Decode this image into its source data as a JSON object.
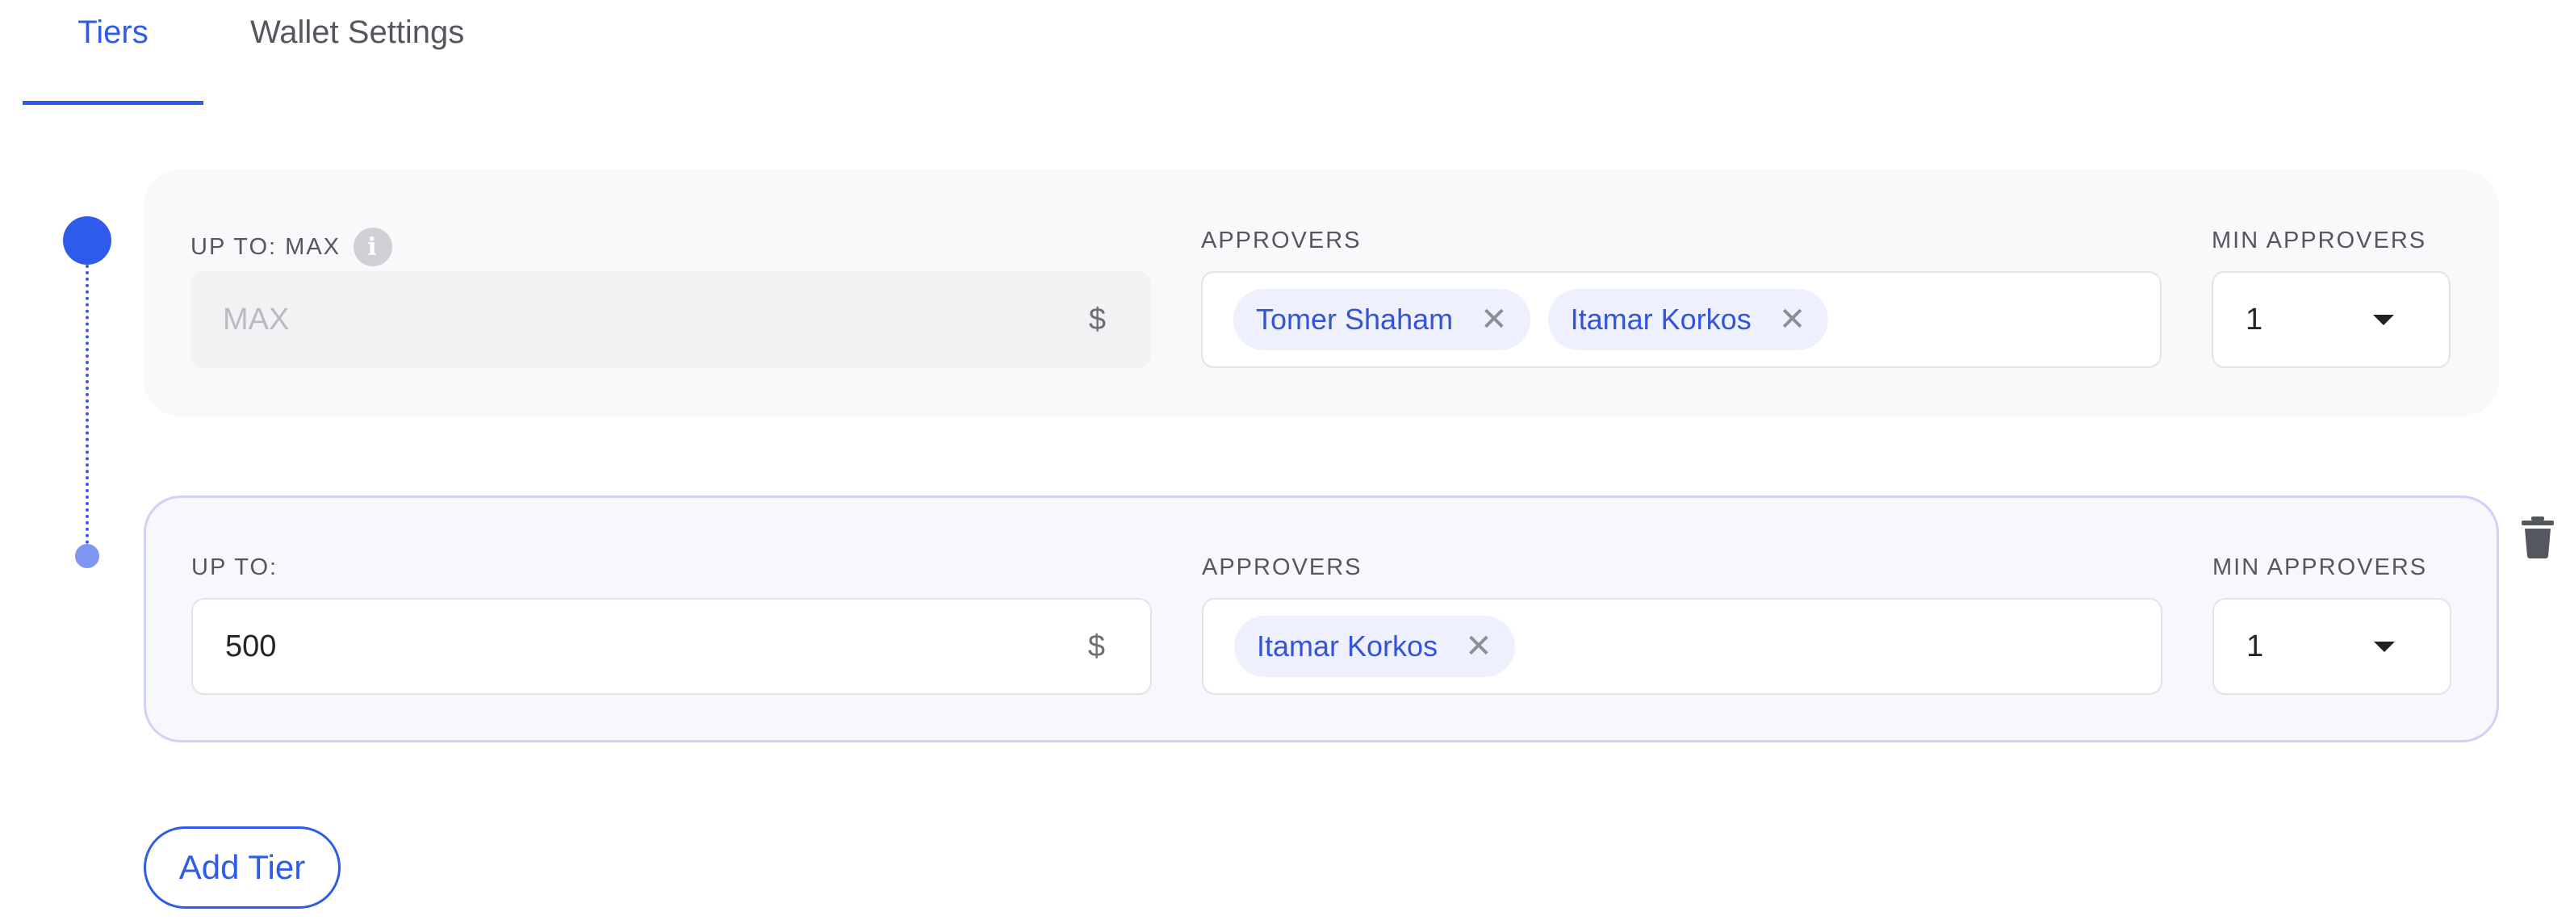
{
  "tabs": [
    {
      "label": "Tiers",
      "active": true
    },
    {
      "label": "Wallet Settings",
      "active": false
    }
  ],
  "tiers": [
    {
      "amount_label": "UP TO: MAX",
      "amount_placeholder": "MAX",
      "amount_value": "",
      "amount_disabled": true,
      "currency_symbol": "$",
      "approvers_label": "APPROVERS",
      "approvers": [
        "Tomer Shaham",
        "Itamar Korkos"
      ],
      "min_approvers_label": "MIN APPROVERS",
      "min_approvers_value": "1"
    },
    {
      "amount_label": "UP TO:",
      "amount_placeholder": "",
      "amount_value": "500",
      "amount_disabled": false,
      "currency_symbol": "$",
      "approvers_label": "APPROVERS",
      "approvers": [
        "Itamar Korkos"
      ],
      "min_approvers_label": "MIN APPROVERS",
      "min_approvers_value": "1"
    }
  ],
  "chip_remove_glyph": "✕",
  "info_glyph": "i",
  "add_tier_label": "Add Tier",
  "icons": {
    "info": "info-icon",
    "remove": "close-icon",
    "dropdown": "chevron-down-icon",
    "delete": "trash-icon"
  },
  "colors": {
    "accent": "#2f5bea",
    "chip_bg": "#eef1fd",
    "chip_text": "#3354d6",
    "timeline_secondary": "#7f97f1"
  }
}
